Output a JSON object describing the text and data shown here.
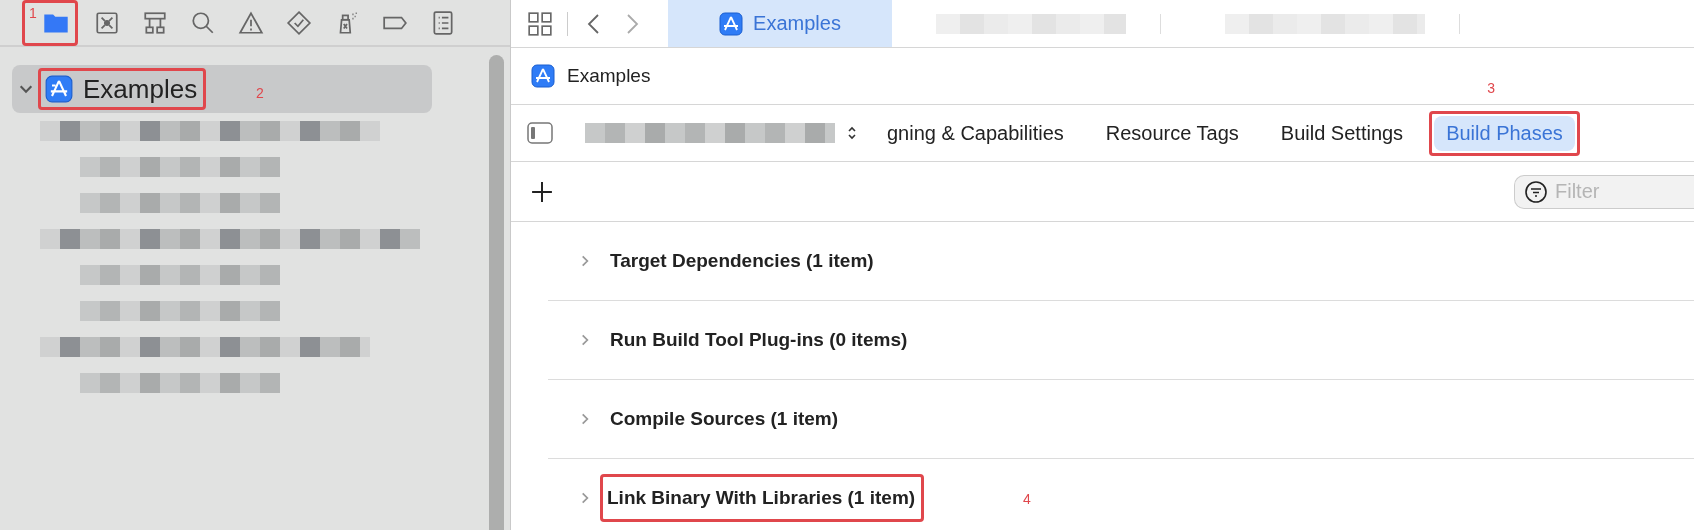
{
  "navigator_toolbar": [
    {
      "kind": "folder",
      "selected": true,
      "annotation": "1"
    },
    {
      "kind": "source-control",
      "selected": false
    },
    {
      "kind": "hierarchy",
      "selected": false
    },
    {
      "kind": "search",
      "selected": false
    },
    {
      "kind": "warning",
      "selected": false
    },
    {
      "kind": "test",
      "selected": false
    },
    {
      "kind": "debug",
      "selected": false
    },
    {
      "kind": "breakpoint",
      "selected": false
    },
    {
      "kind": "report",
      "selected": false
    }
  ],
  "navigator": {
    "label": "Examples",
    "expanded": true,
    "selected": true,
    "annotation": "2"
  },
  "editor_tabs": [
    {
      "label": "Examples",
      "selected": true
    }
  ],
  "jump_bar": {
    "label": "Examples"
  },
  "settings_tabs": [
    {
      "label": "gning & Capabilities",
      "selected": false
    },
    {
      "label": "Resource Tags",
      "selected": false
    },
    {
      "label": "Build Settings",
      "selected": false
    },
    {
      "label": "Build Phases",
      "selected": true,
      "annotation": "3"
    }
  ],
  "filter": {
    "placeholder": "Filter"
  },
  "phases": [
    {
      "label": "Target Dependencies (1 item)",
      "expanded": false
    },
    {
      "label": "Run Build Tool Plug-ins (0 items)",
      "expanded": false
    },
    {
      "label": "Compile Sources (1 item)",
      "expanded": false
    },
    {
      "label": "Link Binary With Libraries (1 item)",
      "expanded": false,
      "annotation": "4"
    }
  ]
}
